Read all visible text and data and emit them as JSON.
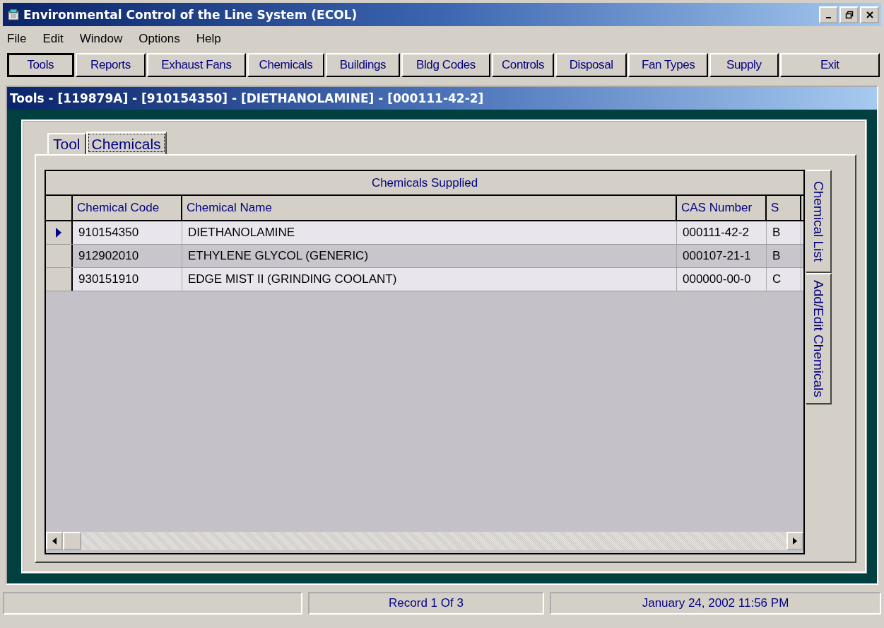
{
  "window": {
    "title": "Environmental Control of the Line System (ECOL)"
  },
  "menu": [
    "File",
    "Edit",
    "Window",
    "Options",
    "Help"
  ],
  "toolbar": [
    {
      "label": "Tools",
      "selected": true
    },
    {
      "label": "Reports",
      "selected": false
    },
    {
      "label": "Exhaust Fans",
      "selected": false
    },
    {
      "label": "Chemicals",
      "selected": false
    },
    {
      "label": "Buildings",
      "selected": false
    },
    {
      "label": "Bldg Codes",
      "selected": false
    },
    {
      "label": "Controls",
      "selected": false
    },
    {
      "label": "Disposal",
      "selected": false
    },
    {
      "label": "Fan Types",
      "selected": false
    },
    {
      "label": "Supply",
      "selected": false
    },
    {
      "label": "Exit",
      "selected": false
    }
  ],
  "child_window": {
    "title": "Tools - [119879A] - [910154350] - [DIETHANOLAMINE] - [000111-42-2]"
  },
  "tabs": [
    {
      "label": "Tool",
      "selected": false
    },
    {
      "label": "Chemicals",
      "selected": true
    }
  ],
  "side_tabs": [
    {
      "label": "Chemical List",
      "selected": true
    },
    {
      "label": "Add/Edit Chemicals",
      "selected": false
    }
  ],
  "table": {
    "title": "Chemicals Supplied",
    "columns": [
      "Chemical Code",
      "Chemical Name",
      "CAS Number",
      "S"
    ],
    "rows": [
      {
        "selected": true,
        "cells": [
          "910154350",
          "DIETHANOLAMINE",
          "000111-42-2",
          "B"
        ]
      },
      {
        "selected": false,
        "cells": [
          "912902010",
          "ETHYLENE GLYCOL (GENERIC)",
          "000107-21-1",
          "B"
        ]
      },
      {
        "selected": false,
        "cells": [
          "930151910",
          "EDGE MIST II (GRINDING COOLANT)",
          "000000-00-0",
          "C"
        ]
      }
    ]
  },
  "status_bar": [
    "Record 1 Of 3",
    "January 24, 2002  11:56 PM"
  ]
}
